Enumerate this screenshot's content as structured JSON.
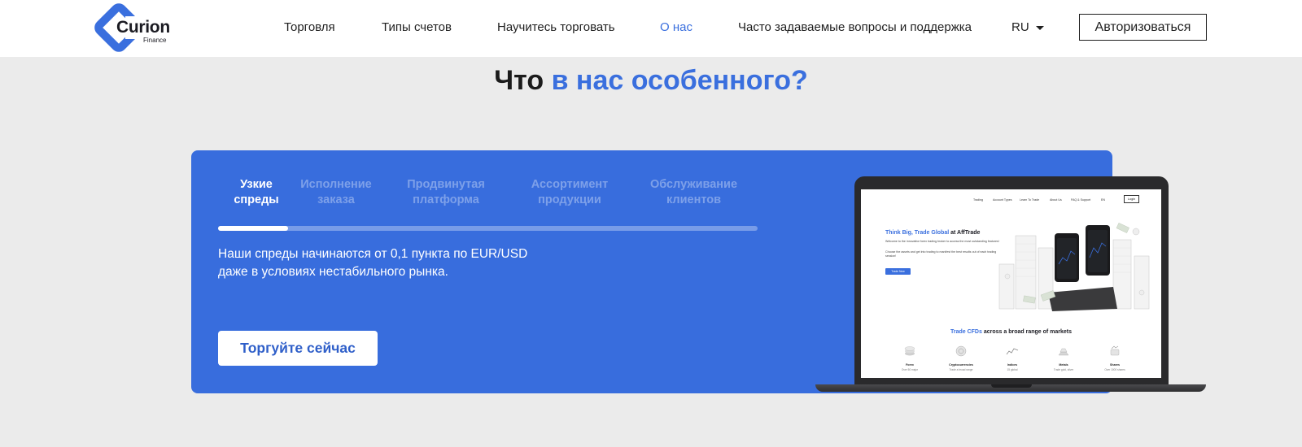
{
  "header": {
    "logo": {
      "name": "Curion",
      "sub": "Finance"
    },
    "nav": [
      {
        "label": "Торговля"
      },
      {
        "label": "Типы счетов"
      },
      {
        "label": "Научитесь торговать"
      },
      {
        "label": "О нас",
        "active": true
      },
      {
        "label": "Часто задаваемые вопросы и поддержка"
      }
    ],
    "language": "RU",
    "login_label": "Авторизоваться"
  },
  "section": {
    "title_part1": "Что",
    "title_part2": "в нас особенного?",
    "tabs": [
      {
        "line1": "Узкие",
        "line2": "спреды",
        "active": true
      },
      {
        "line1": "Исполнение",
        "line2": "заказа"
      },
      {
        "line1": "Продвинутая",
        "line2": "платформа"
      },
      {
        "line1": "Ассортимент",
        "line2": "продукции"
      },
      {
        "line1": "Обслуживание",
        "line2": "клиентов"
      }
    ],
    "progress": 0.13,
    "description": "Наши спреды начинаются от 0,1 пункта по EUR/USD даже в условиях нестабильного рынка.",
    "cta_label": "Торгуйте сейчас"
  },
  "laptop_screen": {
    "nav": [
      "Trading",
      "Account Types",
      "Learn To Trade",
      "About Us",
      "FAQ & Support",
      "EN"
    ],
    "login": "Login",
    "hero_accent": "Think Big, Trade Global",
    "hero_rest": "at AffTrade",
    "hero_text1": "Welcome to the innovative forex trading broker to access the most outstanding features!",
    "hero_text2": "Choose the assets and get into trading to manifest the best results out of each trading session!",
    "hero_button": "Trade Now",
    "section_accent": "Trade CFDs",
    "section_rest": "across a broad range of markets",
    "categories": [
      {
        "name": "Forex",
        "sub": "Over 50 major"
      },
      {
        "name": "Cryptocurrencies",
        "sub": "Trade a broad range"
      },
      {
        "name": "Indices",
        "sub": "15 global"
      },
      {
        "name": "Metals",
        "sub": "Trade gold, silver"
      },
      {
        "name": "Shares",
        "sub": "Over 1000 shares"
      }
    ]
  },
  "colors": {
    "accent": "#3a6fde",
    "card": "#386ddd",
    "page_bg": "#ebebeb"
  }
}
